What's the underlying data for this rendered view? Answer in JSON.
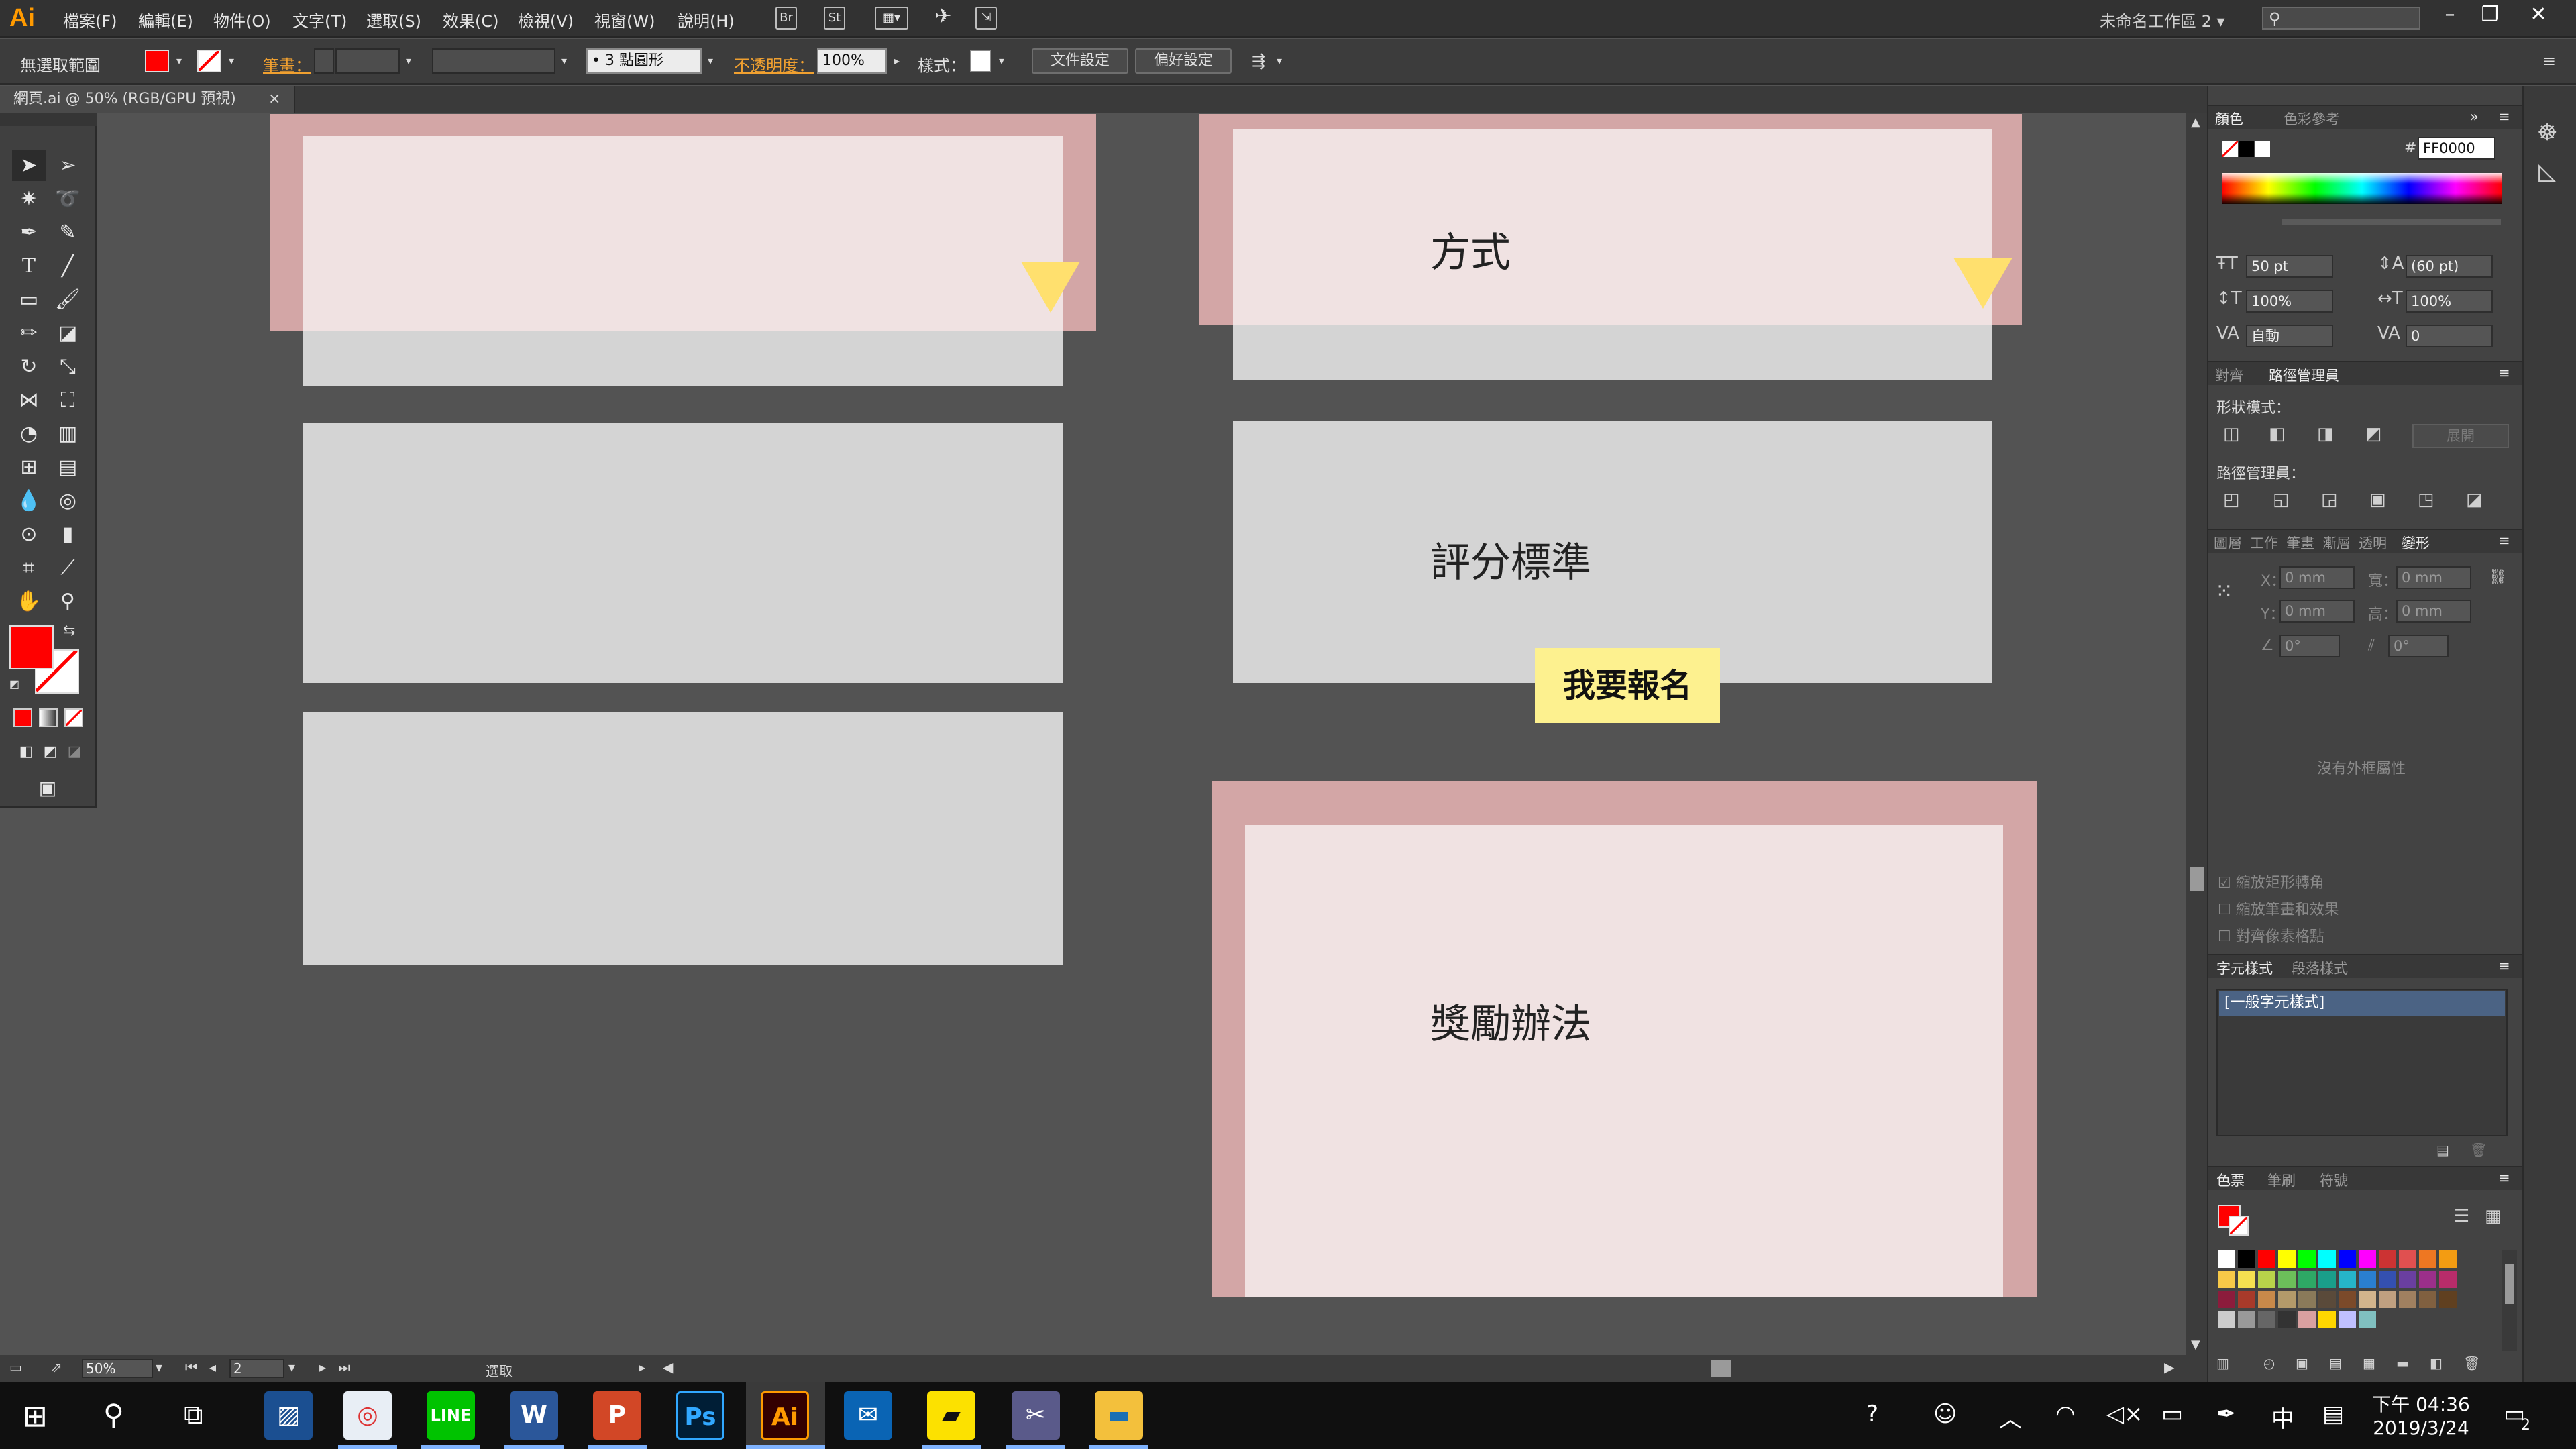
{
  "app": {
    "logo": "Ai",
    "menus": [
      "檔案(F)",
      "編輯(E)",
      "物件(O)",
      "文字(T)",
      "選取(S)",
      "效果(C)",
      "檢視(V)",
      "視窗(W)",
      "說明(H)"
    ],
    "bridge_label": "Br",
    "stock_label": "St",
    "workspace": "未命名工作區 2",
    "window_buttons": [
      "–",
      "❐",
      "✕"
    ]
  },
  "control_bar": {
    "no_selection": "無選取範圍",
    "stroke_link": "筆畫：",
    "brush": "3 點圓形",
    "opacity_link": "不透明度：",
    "opacity_value": "100%",
    "style_label": "樣式：",
    "doc_setup_button": "文件設定",
    "preferences_button": "偏好設定",
    "fill_color": "#ff0000"
  },
  "document_tab": {
    "title": "網頁.ai @ 50% (RGB/GPU 預視)",
    "close": "×"
  },
  "canvas": {
    "cards": [
      {
        "text": ""
      },
      {
        "text": "方式"
      },
      {
        "text": ""
      },
      {
        "text": "評分標準"
      },
      {
        "text": ""
      },
      {
        "text": "獎勵辦法"
      }
    ],
    "signup_button": "我要報名",
    "accent_pink": "#d3a6a6",
    "accent_yellow": "#ffe06e"
  },
  "status_bar": {
    "zoom": "50%",
    "artboard": "2",
    "tool_status": "選取"
  },
  "color_panel": {
    "tabs": [
      "顏色",
      "色彩參考"
    ],
    "hex_label": "#",
    "hex_value": "FF0000"
  },
  "character_panel": {
    "font_size": "50 pt",
    "leading": "(60 pt)",
    "vscale": "100%",
    "hscale": "100%",
    "kerning": "自動",
    "tracking": "0"
  },
  "pathfinder_panel": {
    "tabs": [
      "對齊",
      "路徑管理員"
    ],
    "shape_modes": "形狀模式：",
    "expand": "展開",
    "pathfinders": "路徑管理員："
  },
  "transform_panel": {
    "tabs": [
      "圖層",
      "工作",
      "筆畫",
      "漸層",
      "透明",
      "變形"
    ],
    "x_label": "X：",
    "x_value": "0 mm",
    "y_label": "Y：",
    "y_value": "0 mm",
    "w_label": "寬：",
    "w_value": "0 mm",
    "h_label": "高：",
    "h_value": "0 mm",
    "angle": "0°",
    "shear": "0°",
    "no_shape": "沒有外框屬性",
    "options": [
      "縮放矩形轉角",
      "縮放筆畫和效果",
      "對齊像素格點"
    ]
  },
  "char_styles_panel": {
    "tabs": [
      "字元樣式",
      "段落樣式"
    ],
    "items": [
      "[一般字元樣式]"
    ]
  },
  "swatches_panel": {
    "tabs": [
      "色票",
      "筆刷",
      "符號"
    ],
    "colors": [
      "#ffffff",
      "#000000",
      "#ff0000",
      "#ffff00",
      "#00ff00",
      "#00ffff",
      "#0000ff",
      "#ff00ff",
      "#cc3333",
      "#e05050",
      "#ee7722",
      "#f39c12",
      "#f7c948",
      "#f5e050",
      "#b8d34a",
      "#6cbf5a",
      "#2ea865",
      "#1a9e8a",
      "#26b5c9",
      "#2a7fd0",
      "#3450b0",
      "#6a3fa0",
      "#9b2f8a",
      "#b82c6a",
      "#8c1c3c",
      "#a83a2a",
      "#c8894a",
      "#b39a6a",
      "#8a7a5a",
      "#5a4a3a",
      "#7b4a2a",
      "#d2b48c",
      "#c0a080",
      "#a08060",
      "#806040",
      "#604020",
      "#cccccc",
      "#999999",
      "#666666",
      "#333333",
      "#d9a0a0",
      "#ffd700",
      "#c0c0ff",
      "#80c0c0"
    ]
  },
  "taskbar": {
    "time": "下午 04:36",
    "date": "2019/3/24",
    "ime": "中",
    "notif_count": "2",
    "apps": [
      "Chrome",
      "LINE",
      "W",
      "P",
      "Ps",
      "Ai",
      "Outlook",
      "Sticky",
      "Paint",
      "Explorer"
    ]
  }
}
